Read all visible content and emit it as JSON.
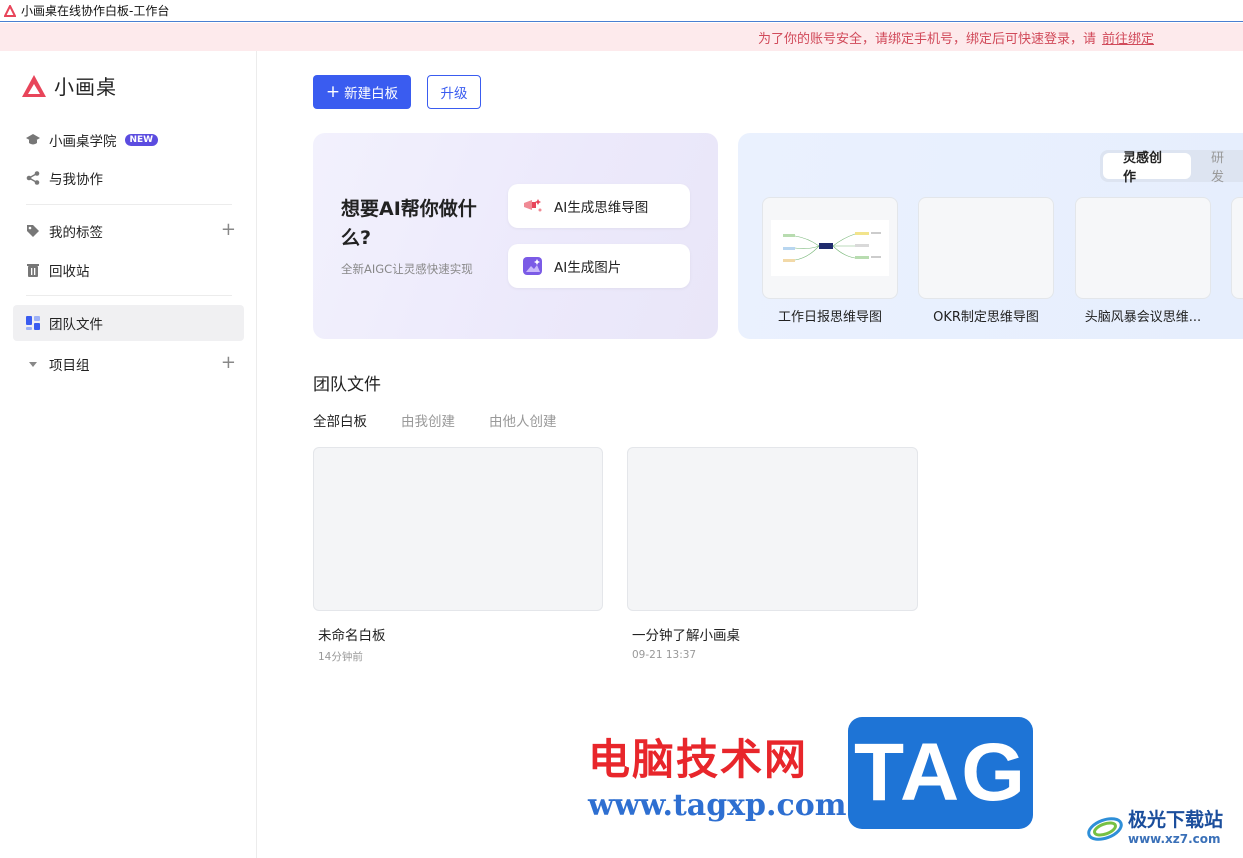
{
  "window": {
    "title": "小画桌在线协作白板-工作台"
  },
  "notice": {
    "text": "为了你的账号安全，请绑定手机号，绑定后可快速登录，请",
    "link": "前往绑定"
  },
  "sidebar": {
    "logo_text": "小画桌",
    "academy": {
      "label": "小画桌学院",
      "badge": "NEW"
    },
    "collab": {
      "label": "与我协作"
    },
    "tags": {
      "label": "我的标签"
    },
    "trash": {
      "label": "回收站"
    },
    "team_files": {
      "label": "团队文件"
    },
    "project_group": {
      "label": "项目组"
    }
  },
  "toolbar": {
    "new_board": "新建白板",
    "upgrade": "升级"
  },
  "ai_card": {
    "title": "想要AI帮你做什么?",
    "subtitle": "全新AIGC让灵感快速实现",
    "mindmap_btn": "AI生成思维导图",
    "image_btn": "AI生成图片"
  },
  "templates": {
    "tabs": [
      "灵感创作",
      "研发"
    ],
    "items": [
      {
        "label": "工作日报思维导图"
      },
      {
        "label": "OKR制定思维导图"
      },
      {
        "label": "头脑风暴会议思维..."
      }
    ]
  },
  "files": {
    "section_title": "团队文件",
    "filters": [
      "全部白板",
      "由我创建",
      "由他人创建"
    ],
    "items": [
      {
        "name": "未命名白板",
        "time": "14分钟前"
      },
      {
        "name": "一分钟了解小画桌",
        "time": "09-21 13:37"
      }
    ]
  },
  "watermark": {
    "site_cn": "电脑技术网",
    "site_url": "www.tagxp.com",
    "tag": "TAG",
    "xz_cn": "极光下载站",
    "xz_url": "www.xz7.com"
  },
  "colors": {
    "primary": "#3a5cf0",
    "brand": "#e8455a",
    "notice_text": "#d14a5a"
  }
}
